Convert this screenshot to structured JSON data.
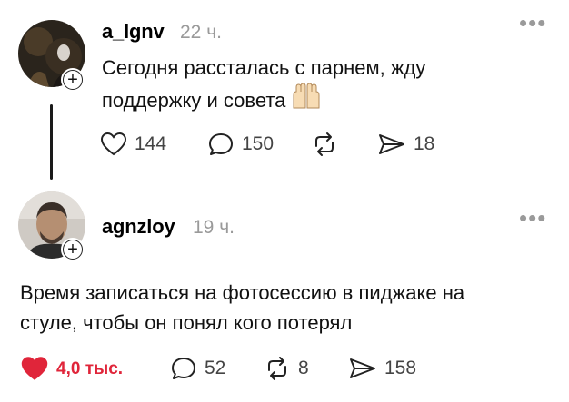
{
  "posts": [
    {
      "username": "a_lgnv",
      "time": "22 ч.",
      "more": "•••",
      "text_line1": "Сегодня рассталась с парнем, жду",
      "text_line2": "поддержку и совета",
      "emoji": "raising-hands",
      "likes": "144",
      "comments": "150",
      "reposts": "",
      "shares": "18",
      "liked": false
    },
    {
      "username": "agnzloy",
      "time": "19 ч.",
      "more": "•••",
      "text_line1": "Время записаться на фотосессию в пиджаке на",
      "text_line2": "стуле, чтобы он понял кого потерял",
      "likes": "4,0 тыс.",
      "comments": "52",
      "reposts": "8",
      "shares": "158",
      "liked": true
    }
  ],
  "colors": {
    "like_active": "#e0253a",
    "muted": "#9a9a9a",
    "thread_line": "#1a1a1a"
  },
  "icons": [
    "heart-icon",
    "comment-icon",
    "repost-icon",
    "share-icon",
    "plus-icon",
    "more-icon",
    "raising-hands-emoji"
  ]
}
